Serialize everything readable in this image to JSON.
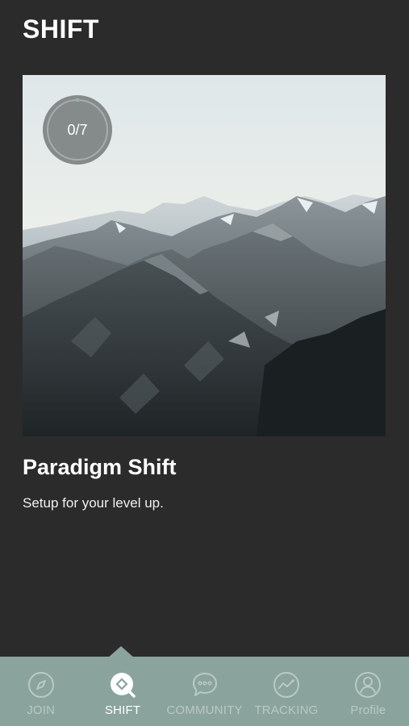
{
  "header": {
    "title": "SHIFT"
  },
  "card": {
    "progress": {
      "completed": 0,
      "total": 7,
      "text": "0/7"
    },
    "image": "mountain-landscape-photo",
    "title": "Paradigm Shift",
    "subtitle": "Setup for your level up."
  },
  "tabs": [
    {
      "id": "join",
      "label": "JOIN",
      "icon": "compass-icon",
      "active": false
    },
    {
      "id": "shift",
      "label": "SHIFT",
      "icon": "shift-search-icon",
      "active": true
    },
    {
      "id": "community",
      "label": "COMMUNITY",
      "icon": "chat-bubble-icon",
      "active": false
    },
    {
      "id": "tracking",
      "label": "TRACKING",
      "icon": "trend-graph-icon",
      "active": false
    },
    {
      "id": "profile",
      "label": "Profile",
      "icon": "user-icon",
      "active": false
    }
  ],
  "colors": {
    "background": "#2b2b2b",
    "tab_bar": "#8ba39d",
    "tab_inactive": "#b9c9c4",
    "tab_active": "#ffffff"
  }
}
